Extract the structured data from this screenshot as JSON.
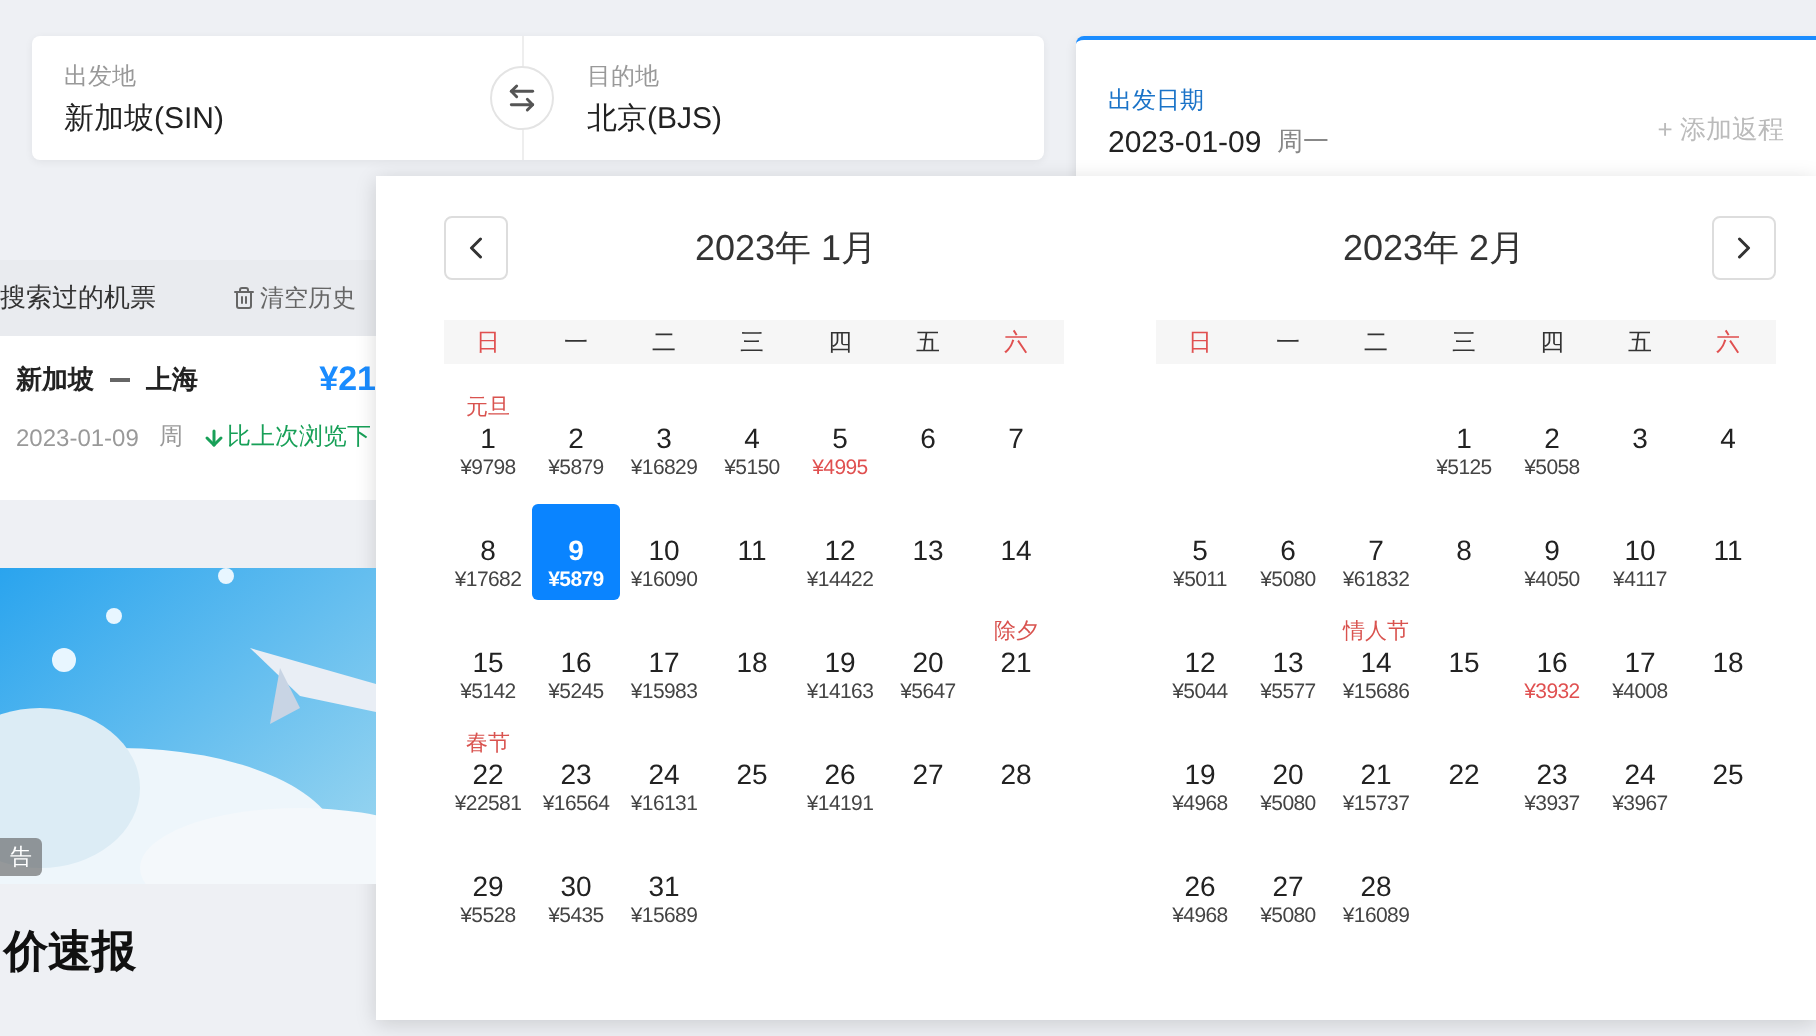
{
  "search": {
    "origin": {
      "label": "出发地",
      "value": "新加坡(SIN)"
    },
    "destination": {
      "label": "目的地",
      "value": "北京(BJS)"
    },
    "date": {
      "label": "出发日期",
      "value": "2023-01-09",
      "weekday": "周一",
      "add_return": "+ 添加返程"
    }
  },
  "history": {
    "title": "搜索过的机票",
    "clear": "清空历史",
    "trip": {
      "from": "新加坡",
      "to": "上海",
      "price": "¥21",
      "date": "2023-01-09",
      "weekday": "周",
      "note": "比上次浏览下"
    }
  },
  "ad": {
    "kind": "picture",
    "tag": "告"
  },
  "section_title": "价速报",
  "months": [
    {
      "title": "2023年 1月",
      "weekdays": [
        {
          "label": "日",
          "weekend": true
        },
        {
          "label": "一",
          "weekend": false
        },
        {
          "label": "二",
          "weekend": false
        },
        {
          "label": "三",
          "weekend": false
        },
        {
          "label": "四",
          "weekend": false
        },
        {
          "label": "五",
          "weekend": false
        },
        {
          "label": "六",
          "weekend": true
        }
      ],
      "cells": [
        {
          "day": "1",
          "price": "¥9798",
          "holiday": "元旦",
          "low": false,
          "selected": false
        },
        {
          "day": "2",
          "price": "¥5879",
          "low": false,
          "selected": false
        },
        {
          "day": "3",
          "price": "¥16829",
          "low": false,
          "selected": false
        },
        {
          "day": "4",
          "price": "¥5150",
          "low": false,
          "selected": false
        },
        {
          "day": "5",
          "price": "¥4995",
          "low": true,
          "selected": false
        },
        {
          "day": "6",
          "selected": false
        },
        {
          "day": "7",
          "selected": false
        },
        {
          "day": "8",
          "price": "¥17682",
          "low": false,
          "selected": false
        },
        {
          "day": "9",
          "price": "¥5879",
          "low": false,
          "selected": true
        },
        {
          "day": "10",
          "price": "¥16090",
          "low": false,
          "selected": false
        },
        {
          "day": "11",
          "selected": false
        },
        {
          "day": "12",
          "price": "¥14422",
          "low": false,
          "selected": false
        },
        {
          "day": "13",
          "selected": false
        },
        {
          "day": "14",
          "selected": false
        },
        {
          "day": "15",
          "price": "¥5142",
          "low": false,
          "selected": false
        },
        {
          "day": "16",
          "price": "¥5245",
          "low": false,
          "selected": false
        },
        {
          "day": "17",
          "price": "¥15983",
          "low": false,
          "selected": false
        },
        {
          "day": "18",
          "selected": false
        },
        {
          "day": "19",
          "price": "¥14163",
          "low": false,
          "selected": false
        },
        {
          "day": "20",
          "price": "¥5647",
          "low": false,
          "selected": false
        },
        {
          "day": "21",
          "holiday": "除夕",
          "selected": false
        },
        {
          "day": "22",
          "price": "¥22581",
          "holiday": "春节",
          "low": false,
          "selected": false
        },
        {
          "day": "23",
          "price": "¥16564",
          "low": false,
          "selected": false
        },
        {
          "day": "24",
          "price": "¥16131",
          "low": false,
          "selected": false
        },
        {
          "day": "25",
          "selected": false
        },
        {
          "day": "26",
          "price": "¥14191",
          "low": false,
          "selected": false
        },
        {
          "day": "27",
          "selected": false
        },
        {
          "day": "28",
          "selected": false
        },
        {
          "day": "29",
          "price": "¥5528",
          "low": false,
          "selected": false
        },
        {
          "day": "30",
          "price": "¥5435",
          "low": false,
          "selected": false
        },
        {
          "day": "31",
          "price": "¥15689",
          "low": false,
          "selected": false
        }
      ]
    },
    {
      "title": "2023年 2月",
      "weekdays": [
        {
          "label": "日",
          "weekend": true
        },
        {
          "label": "一",
          "weekend": false
        },
        {
          "label": "二",
          "weekend": false
        },
        {
          "label": "三",
          "weekend": false
        },
        {
          "label": "四",
          "weekend": false
        },
        {
          "label": "五",
          "weekend": false
        },
        {
          "label": "六",
          "weekend": true
        }
      ],
      "cells": [
        null,
        null,
        null,
        {
          "day": "1",
          "price": "¥5125",
          "low": false,
          "selected": false
        },
        {
          "day": "2",
          "price": "¥5058",
          "low": false,
          "selected": false
        },
        {
          "day": "3",
          "selected": false
        },
        {
          "day": "4",
          "selected": false
        },
        {
          "day": "5",
          "price": "¥5011",
          "low": false,
          "selected": false
        },
        {
          "day": "6",
          "price": "¥5080",
          "low": false,
          "selected": false
        },
        {
          "day": "7",
          "price": "¥61832",
          "low": false,
          "selected": false
        },
        {
          "day": "8",
          "selected": false
        },
        {
          "day": "9",
          "price": "¥4050",
          "low": false,
          "selected": false
        },
        {
          "day": "10",
          "price": "¥4117",
          "low": false,
          "selected": false
        },
        {
          "day": "11",
          "selected": false
        },
        {
          "day": "12",
          "price": "¥5044",
          "low": false,
          "selected": false
        },
        {
          "day": "13",
          "price": "¥5577",
          "low": false,
          "selected": false
        },
        {
          "day": "14",
          "price": "¥15686",
          "holiday": "情人节",
          "low": false,
          "selected": false
        },
        {
          "day": "15",
          "selected": false
        },
        {
          "day": "16",
          "price": "¥3932",
          "low": true,
          "selected": false
        },
        {
          "day": "17",
          "price": "¥4008",
          "low": false,
          "selected": false
        },
        {
          "day": "18",
          "selected": false
        },
        {
          "day": "19",
          "price": "¥4968",
          "low": false,
          "selected": false
        },
        {
          "day": "20",
          "price": "¥5080",
          "low": false,
          "selected": false
        },
        {
          "day": "21",
          "price": "¥15737",
          "low": false,
          "selected": false
        },
        {
          "day": "22",
          "selected": false
        },
        {
          "day": "23",
          "price": "¥3937",
          "low": false,
          "selected": false
        },
        {
          "day": "24",
          "price": "¥3967",
          "low": false,
          "selected": false
        },
        {
          "day": "25",
          "selected": false
        },
        {
          "day": "26",
          "price": "¥4968",
          "low": false,
          "selected": false
        },
        {
          "day": "27",
          "price": "¥5080",
          "low": false,
          "selected": false
        },
        {
          "day": "28",
          "price": "¥16089",
          "low": false,
          "selected": false
        }
      ]
    }
  ]
}
